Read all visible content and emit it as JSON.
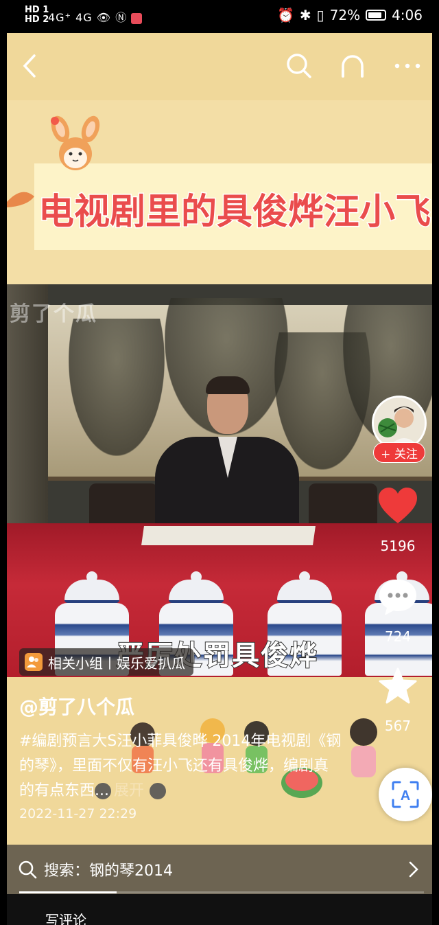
{
  "status_bar": {
    "network_left": "4G⁺ 4G",
    "hd_top": "HD 1",
    "hd_bottom": "HD 2",
    "battery": "72%",
    "time": "4:06"
  },
  "banner": {
    "title": "电视剧里的具俊烨汪小飞"
  },
  "video": {
    "watermark": "剪了个瓜",
    "subtitle": "严厉处罚具俊烨"
  },
  "group_tag": {
    "label": "相关小组丨娱乐爱扒瓜"
  },
  "rail": {
    "follow_label": "+ 关注",
    "likes": "5196",
    "comments": "724",
    "favorites": "567"
  },
  "post": {
    "author": "@剪了八个瓜",
    "description": "#编剧预言大S汪小菲具俊晔 2014年电视剧《钢的琴》，里面不仅有汪小飞还有具俊烨，编剧真的有点东西...",
    "expand_label": "展开",
    "date": "2022-11-27 22:29"
  },
  "search": {
    "label": "搜索：钢的琴2014"
  },
  "video_progress": 0.24,
  "bottom": {
    "partial": "写评论"
  },
  "colors": {
    "accent_red": "#ee3a3a",
    "banner_text": "#ea4c4c",
    "background": "#f0d89a"
  }
}
